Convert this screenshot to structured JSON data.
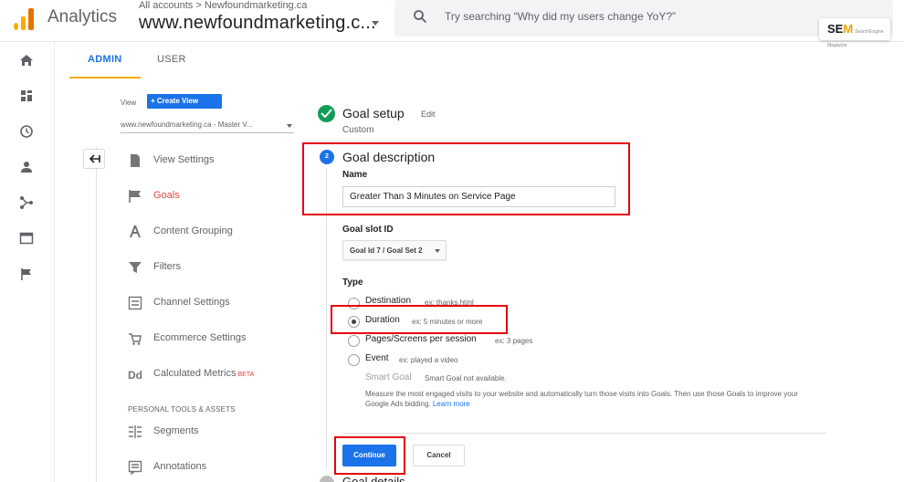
{
  "header": {
    "brand": "Analytics",
    "breadcrumb": "All accounts > Newfoundmarketing.ca",
    "account": "www.newfoundmarketing.c...",
    "search_placeholder": "Try searching “Why did my users change YoY?”",
    "badge_sem": "SE",
    "badge_m": "M",
    "badge_small": "SearchEngine Magazine"
  },
  "tabs": {
    "admin": "ADMIN",
    "user": "USER"
  },
  "view": {
    "label": "View",
    "create_button": "+ Create View",
    "selected": "www.newfoundmarketing.ca - Master V..."
  },
  "nav": {
    "items": [
      {
        "label": "View Settings",
        "icon": "page-icon"
      },
      {
        "label": "Goals",
        "icon": "flag-icon"
      },
      {
        "label": "Content Grouping",
        "icon": "person-walk-icon"
      },
      {
        "label": "Filters",
        "icon": "funnel-icon"
      },
      {
        "label": "Channel Settings",
        "icon": "channel-icon"
      },
      {
        "label": "Ecommerce Settings",
        "icon": "cart-icon"
      },
      {
        "label": "Calculated Metrics",
        "icon": "dd-icon",
        "badge": "BETA"
      }
    ],
    "section_header": "PERSONAL TOOLS & ASSETS",
    "tools": [
      {
        "label": "Segments",
        "icon": "segments-icon"
      },
      {
        "label": "Annotations",
        "icon": "annotations-icon"
      }
    ]
  },
  "goal_setup": {
    "title": "Goal setup",
    "edit": "Edit",
    "subtitle": "Custom"
  },
  "goal_description": {
    "step_number": "2",
    "title": "Goal description",
    "name_label": "Name",
    "name_value": "Greater Than 3 Minutes on Service Page",
    "slot_label": "Goal slot ID",
    "slot_value": "Goal Id 7 / Goal Set 2",
    "type_label": "Type",
    "options": [
      {
        "label": "Destination",
        "example": "ex: thanks.html",
        "selected": false
      },
      {
        "label": "Duration",
        "example": "ex: 5 minutes or more",
        "selected": true
      },
      {
        "label": "Pages/Screens per session",
        "example": "ex: 3 pages",
        "selected": false
      },
      {
        "label": "Event",
        "example": "ex: played a video",
        "selected": false
      }
    ],
    "smart_goal": "Smart Goal",
    "smart_goal_note": "Smart Goal not available.",
    "smart_desc": "Measure the most engaged visits to your website and automatically turn those visits into Goals. Then use those Goals to improve your Google Ads bidding.",
    "learn_more": "Learn more",
    "continue": "Continue",
    "cancel": "Cancel"
  },
  "goal_details": {
    "title": "Goal details"
  },
  "colors": {
    "accent": "#1a73e8",
    "brand": "#f9ab00",
    "active_nav": "#e8453c",
    "success": "#0f9d58",
    "annotation": "#e3000f"
  }
}
